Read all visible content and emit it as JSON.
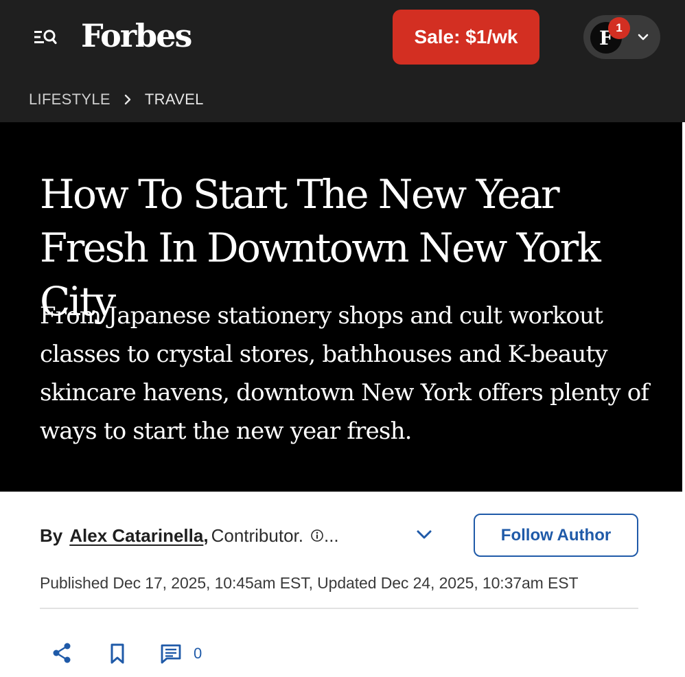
{
  "header": {
    "logo_text": "Forbes",
    "menu_icon": "menu-search-icon",
    "sale_label": "Sale: $1/wk",
    "account": {
      "avatar_letter": "F",
      "notification_count": "1",
      "dropdown_icon": "chevron-down-icon"
    }
  },
  "breadcrumb": {
    "items": [
      "LIFESTYLE",
      "TRAVEL"
    ],
    "separator_icon": "chevron-right-icon"
  },
  "article": {
    "headline": "How To Start The New Year Fresh In Downtown New York City",
    "dek": "From Japanese stationery shops and cult workout classes to crystal stores, bathhouses and K-beauty skincare havens, downtown New York offers plenty of ways to start the new year fresh.",
    "byline": {
      "prefix": "By",
      "author": "Alex Catarinella",
      "comma": ",",
      "role": "Contributor.",
      "ellipsis": "...",
      "info_icon": "info-circle-icon",
      "expand_icon": "chevron-down-icon"
    },
    "follow_label": "Follow Author",
    "dateline": "Published Dec 17, 2025, 10:45am EST, Updated Dec 24, 2025, 10:37am EST"
  },
  "actions": {
    "share_icon": "share-icon",
    "bookmark_icon": "bookmark-icon",
    "comments_icon": "comment-icon",
    "comment_count": "0"
  },
  "colors": {
    "topbar_bg": "#1f1f1f",
    "hero_bg": "#000000",
    "sale_red": "#d32f22",
    "link_blue": "#1f5aa8"
  }
}
